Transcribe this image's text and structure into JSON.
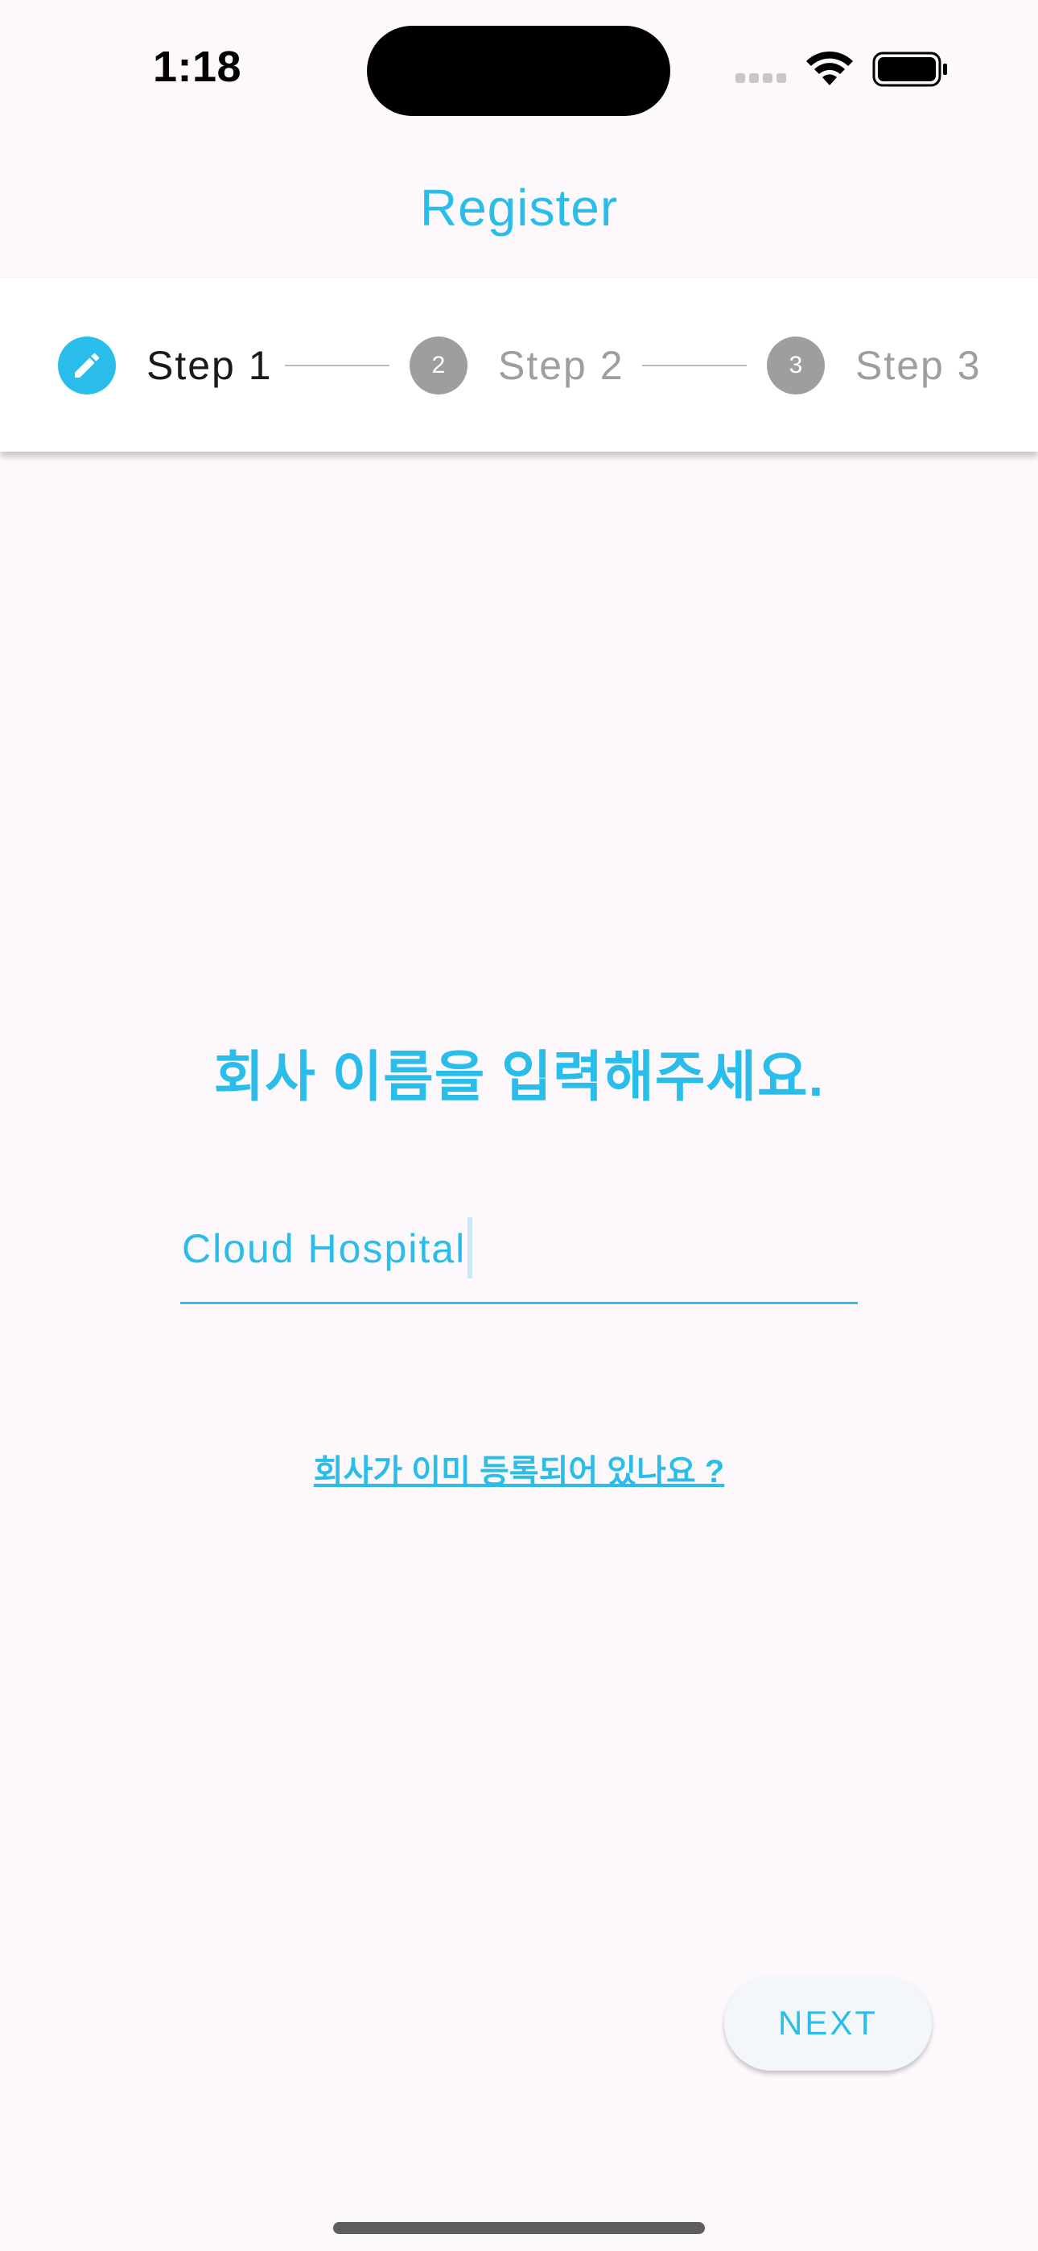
{
  "status_bar": {
    "time": "1:18",
    "icons": [
      "cellular-signal-icon",
      "wifi-icon",
      "battery-icon"
    ]
  },
  "app_bar": {
    "title": "Register"
  },
  "stepper": {
    "steps": [
      {
        "number": "1",
        "label": "Step 1",
        "state": "editing",
        "icon": "pencil-icon"
      },
      {
        "number": "2",
        "label": "Step 2",
        "state": "indexed"
      },
      {
        "number": "3",
        "label": "Step 3",
        "state": "indexed"
      }
    ]
  },
  "form": {
    "heading": "회사 이름을 입력해주세요.",
    "company_name_value": "Cloud Hospital",
    "already_registered_link": "회사가 이미 등록되어 있나요 ?"
  },
  "actions": {
    "next_label": "NEXT"
  },
  "colors": {
    "accent": "#2bbde9",
    "inactive_step": "#9e9e9e",
    "background": "#fdf8fc"
  }
}
